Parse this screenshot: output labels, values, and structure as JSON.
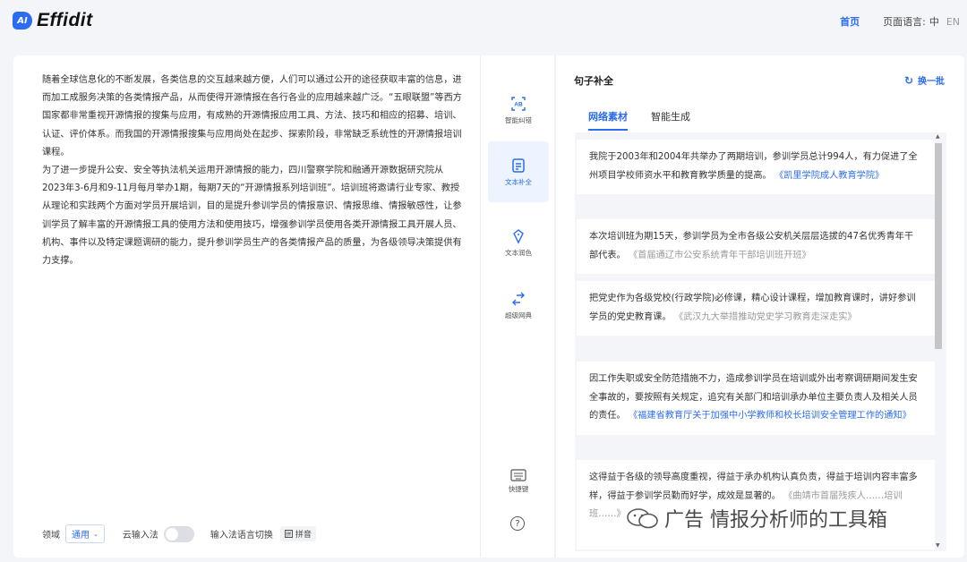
{
  "brand": {
    "badge": "AI",
    "name": "Effidit",
    "accent": "#2b6cf0"
  },
  "nav": {
    "home": "首页",
    "lang_label": "页面语言:",
    "lang_zh": "中",
    "lang_en": "EN"
  },
  "article": {
    "paragraphs": [
      "随着全球信息化的不断发展，各类信息的交互越来越方便，人们可以通过公开的途径获取丰富的信息，进而加工成服务决策的各类情报产品，从而使得开源情报在各行各业的应用越来越广泛。“五眼联盟”等西方国家都非常重视开源情报的搜集与应用，有成熟的开源情报应用工具、方法、技巧和相应的招募、培训、认证、评价体系。而我国的开源情报搜集与应用尚处在起步、探索阶段，非常缺乏系统性的开源情报培训课程。",
      "为了进一步提升公安、安全等执法机关运用开源情报的能力，四川警察学院和融通开源数据研究院从2023年3-6月和9-11月每月举办1期，每期7天的“开源情报系列培训班”。培训班将邀请行业专家、教授从理论和实践两个方面对学员开展培训，目的是提升参训学员的情报意识、情报思维、情报敏感性，让参训学员了解丰富的开源情报工具的使用方法和使用技巧，增强参训学员使用各类开源情报工具开展人员、机构、事件以及特定课题调研的能力，提升参训学员生产的各类情报产品的质量，为各级领导决策提供有力支撑。"
    ]
  },
  "bottombar": {
    "field_label": "领域",
    "field_value": "通用",
    "cloud_input_label": "云输入法",
    "switch_label": "输入法语言切换",
    "pinyin_label": "拼音"
  },
  "toolbar": {
    "tools": [
      {
        "label": "智能纠错",
        "icon": "ai-correct-icon",
        "active": false
      },
      {
        "label": "文本补全",
        "icon": "text-complete-icon",
        "active": true
      },
      {
        "label": "文本润色",
        "icon": "polish-icon",
        "active": false
      },
      {
        "label": "超级网典",
        "icon": "dictionary-icon",
        "active": false
      }
    ],
    "shortcut_label": "快捷键",
    "help": "?"
  },
  "panel": {
    "title": "句子补全",
    "refresh": "换一批",
    "tabs": [
      "网络素材",
      "智能生成"
    ],
    "active_tab": 0
  },
  "results": [
    {
      "text": "我院于2003年和2004年共举办了两期培训，参训学员总计994人，有力促进了全州项目学校师资水平和教育教学质量的提高。",
      "source": "《凯里学院成人教育学院》",
      "link": true
    },
    {
      "text": "本次培训班为期15天，参训学员为全市各级公安机关层层选拔的47名优秀青年干部代表。",
      "source": "《首届通辽市公安系统青年干部培训班开班》",
      "link": false
    },
    {
      "text": "把党史作为各级党校(行政学院)必修课，精心设计课程，增加教育课时，讲好参训学员的党史教育课。",
      "source": "《武汉九大举措推动党史学习教育走深走实》",
      "link": false
    },
    {
      "text": "因工作失职或安全防范措施不力，造成参训学员在培训或外出考察调研期间发生安全事故的，要按照有关规定，追究有关部门和培训承办单位主要负责人及相关人员的责任。",
      "source": "《福建省教育厅关于加强中小学教师和校长培训安全管理工作的通知》",
      "link": true
    },
    {
      "text": "这得益于各级的领导高度重视，得益于承办机构认真负责，得益于培训内容丰富多样，得益于参训学员勤而好学，成效是显著的。",
      "source": "《曲靖市首届残疾人……培训班……》",
      "link": false
    }
  ],
  "watermark": "广告 情报分析师的工具箱"
}
